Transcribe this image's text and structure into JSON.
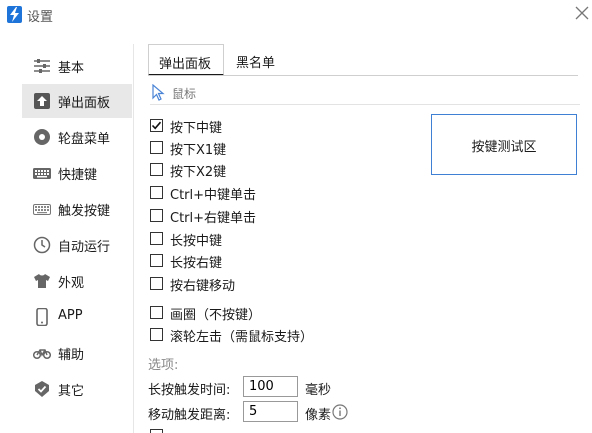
{
  "window": {
    "title": "设置",
    "icon": "lightning-icon",
    "close_icon": "close-icon"
  },
  "sidebar": {
    "active_index": 1,
    "items": [
      {
        "label": "基本",
        "icon": "sliders-icon"
      },
      {
        "label": "弹出面板",
        "icon": "upload-icon"
      },
      {
        "label": "轮盘菜单",
        "icon": "wheel-icon"
      },
      {
        "label": "快捷键",
        "icon": "keyboard-icon"
      },
      {
        "label": "触发按键",
        "icon": "keyboard-outline-icon"
      },
      {
        "label": "自动运行",
        "icon": "clock-icon"
      },
      {
        "label": "外观",
        "icon": "shirt-icon"
      },
      {
        "label": "APP",
        "icon": "phone-icon"
      },
      {
        "label": "辅助",
        "icon": "bicycle-icon"
      },
      {
        "label": "其它",
        "icon": "check-badge-icon"
      }
    ]
  },
  "tabs": [
    {
      "label": "弹出面板",
      "active": true
    },
    {
      "label": "黑名单",
      "active": false
    }
  ],
  "section": {
    "title": "鼠标",
    "icon": "cursor-icon"
  },
  "checkboxes": [
    {
      "label": "按下中键",
      "checked": true
    },
    {
      "label": "按下X1键",
      "checked": false
    },
    {
      "label": "按下X2键",
      "checked": false
    },
    {
      "label": "Ctrl+中键单击",
      "checked": false
    },
    {
      "label": "Ctrl+右键单击",
      "checked": false
    },
    {
      "label": "长按中键",
      "checked": false
    },
    {
      "label": "长按右键",
      "checked": false
    },
    {
      "label": "按右键移动",
      "checked": false
    },
    {
      "label": "画圈（不按键）",
      "checked": false
    },
    {
      "label": "滚轮左击（需鼠标支持）",
      "checked": false
    }
  ],
  "test_area": {
    "label": "按键测试区"
  },
  "options": {
    "title": "选项:",
    "long_press": {
      "label": "长按触发时间:",
      "value": "100",
      "unit": "毫秒"
    },
    "move_distance": {
      "label": "移动触发距离:",
      "value": "5",
      "unit": "像素",
      "info_icon": "info-icon"
    }
  },
  "colors": {
    "accent": "#1f74d9",
    "active_bg": "#e8e8e8",
    "test_border": "#3f7fd4"
  }
}
